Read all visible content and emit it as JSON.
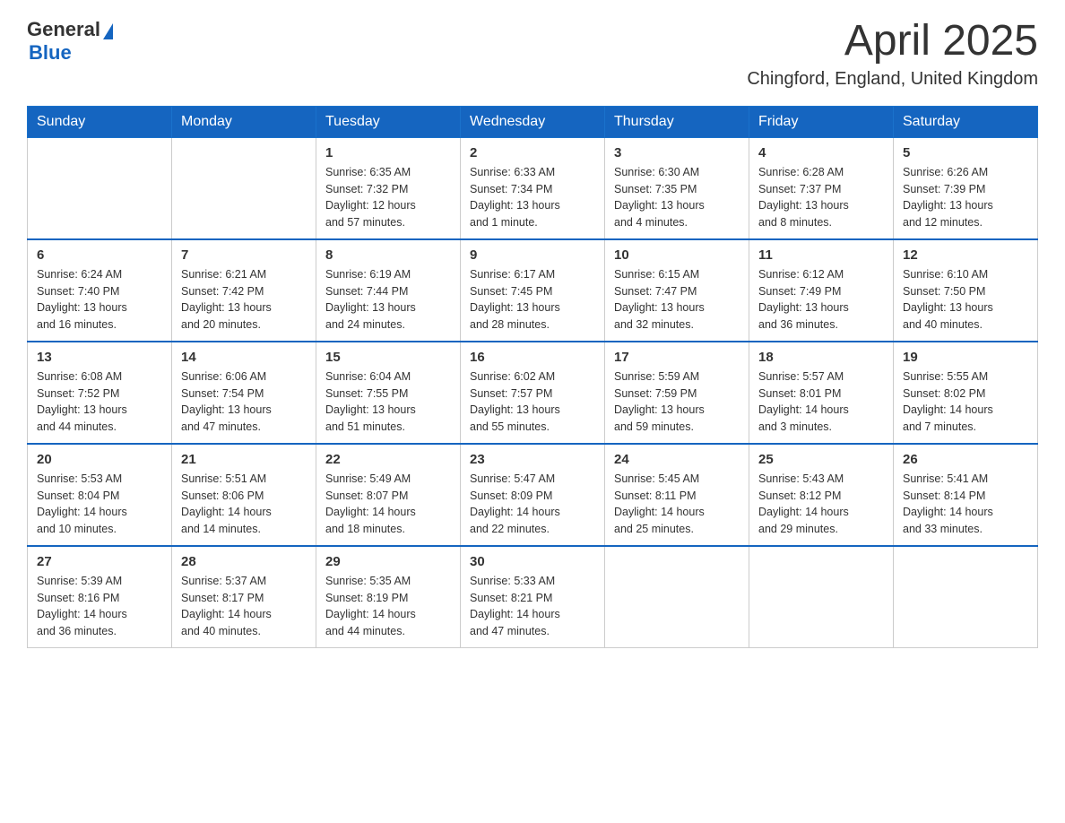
{
  "header": {
    "logo": {
      "text_general": "General",
      "text_blue": "Blue"
    },
    "title": "April 2025",
    "location": "Chingford, England, United Kingdom"
  },
  "calendar": {
    "headers": [
      "Sunday",
      "Monday",
      "Tuesday",
      "Wednesday",
      "Thursday",
      "Friday",
      "Saturday"
    ],
    "weeks": [
      [
        {
          "day": "",
          "info": ""
        },
        {
          "day": "",
          "info": ""
        },
        {
          "day": "1",
          "info": "Sunrise: 6:35 AM\nSunset: 7:32 PM\nDaylight: 12 hours\nand 57 minutes."
        },
        {
          "day": "2",
          "info": "Sunrise: 6:33 AM\nSunset: 7:34 PM\nDaylight: 13 hours\nand 1 minute."
        },
        {
          "day": "3",
          "info": "Sunrise: 6:30 AM\nSunset: 7:35 PM\nDaylight: 13 hours\nand 4 minutes."
        },
        {
          "day": "4",
          "info": "Sunrise: 6:28 AM\nSunset: 7:37 PM\nDaylight: 13 hours\nand 8 minutes."
        },
        {
          "day": "5",
          "info": "Sunrise: 6:26 AM\nSunset: 7:39 PM\nDaylight: 13 hours\nand 12 minutes."
        }
      ],
      [
        {
          "day": "6",
          "info": "Sunrise: 6:24 AM\nSunset: 7:40 PM\nDaylight: 13 hours\nand 16 minutes."
        },
        {
          "day": "7",
          "info": "Sunrise: 6:21 AM\nSunset: 7:42 PM\nDaylight: 13 hours\nand 20 minutes."
        },
        {
          "day": "8",
          "info": "Sunrise: 6:19 AM\nSunset: 7:44 PM\nDaylight: 13 hours\nand 24 minutes."
        },
        {
          "day": "9",
          "info": "Sunrise: 6:17 AM\nSunset: 7:45 PM\nDaylight: 13 hours\nand 28 minutes."
        },
        {
          "day": "10",
          "info": "Sunrise: 6:15 AM\nSunset: 7:47 PM\nDaylight: 13 hours\nand 32 minutes."
        },
        {
          "day": "11",
          "info": "Sunrise: 6:12 AM\nSunset: 7:49 PM\nDaylight: 13 hours\nand 36 minutes."
        },
        {
          "day": "12",
          "info": "Sunrise: 6:10 AM\nSunset: 7:50 PM\nDaylight: 13 hours\nand 40 minutes."
        }
      ],
      [
        {
          "day": "13",
          "info": "Sunrise: 6:08 AM\nSunset: 7:52 PM\nDaylight: 13 hours\nand 44 minutes."
        },
        {
          "day": "14",
          "info": "Sunrise: 6:06 AM\nSunset: 7:54 PM\nDaylight: 13 hours\nand 47 minutes."
        },
        {
          "day": "15",
          "info": "Sunrise: 6:04 AM\nSunset: 7:55 PM\nDaylight: 13 hours\nand 51 minutes."
        },
        {
          "day": "16",
          "info": "Sunrise: 6:02 AM\nSunset: 7:57 PM\nDaylight: 13 hours\nand 55 minutes."
        },
        {
          "day": "17",
          "info": "Sunrise: 5:59 AM\nSunset: 7:59 PM\nDaylight: 13 hours\nand 59 minutes."
        },
        {
          "day": "18",
          "info": "Sunrise: 5:57 AM\nSunset: 8:01 PM\nDaylight: 14 hours\nand 3 minutes."
        },
        {
          "day": "19",
          "info": "Sunrise: 5:55 AM\nSunset: 8:02 PM\nDaylight: 14 hours\nand 7 minutes."
        }
      ],
      [
        {
          "day": "20",
          "info": "Sunrise: 5:53 AM\nSunset: 8:04 PM\nDaylight: 14 hours\nand 10 minutes."
        },
        {
          "day": "21",
          "info": "Sunrise: 5:51 AM\nSunset: 8:06 PM\nDaylight: 14 hours\nand 14 minutes."
        },
        {
          "day": "22",
          "info": "Sunrise: 5:49 AM\nSunset: 8:07 PM\nDaylight: 14 hours\nand 18 minutes."
        },
        {
          "day": "23",
          "info": "Sunrise: 5:47 AM\nSunset: 8:09 PM\nDaylight: 14 hours\nand 22 minutes."
        },
        {
          "day": "24",
          "info": "Sunrise: 5:45 AM\nSunset: 8:11 PM\nDaylight: 14 hours\nand 25 minutes."
        },
        {
          "day": "25",
          "info": "Sunrise: 5:43 AM\nSunset: 8:12 PM\nDaylight: 14 hours\nand 29 minutes."
        },
        {
          "day": "26",
          "info": "Sunrise: 5:41 AM\nSunset: 8:14 PM\nDaylight: 14 hours\nand 33 minutes."
        }
      ],
      [
        {
          "day": "27",
          "info": "Sunrise: 5:39 AM\nSunset: 8:16 PM\nDaylight: 14 hours\nand 36 minutes."
        },
        {
          "day": "28",
          "info": "Sunrise: 5:37 AM\nSunset: 8:17 PM\nDaylight: 14 hours\nand 40 minutes."
        },
        {
          "day": "29",
          "info": "Sunrise: 5:35 AM\nSunset: 8:19 PM\nDaylight: 14 hours\nand 44 minutes."
        },
        {
          "day": "30",
          "info": "Sunrise: 5:33 AM\nSunset: 8:21 PM\nDaylight: 14 hours\nand 47 minutes."
        },
        {
          "day": "",
          "info": ""
        },
        {
          "day": "",
          "info": ""
        },
        {
          "day": "",
          "info": ""
        }
      ]
    ]
  }
}
